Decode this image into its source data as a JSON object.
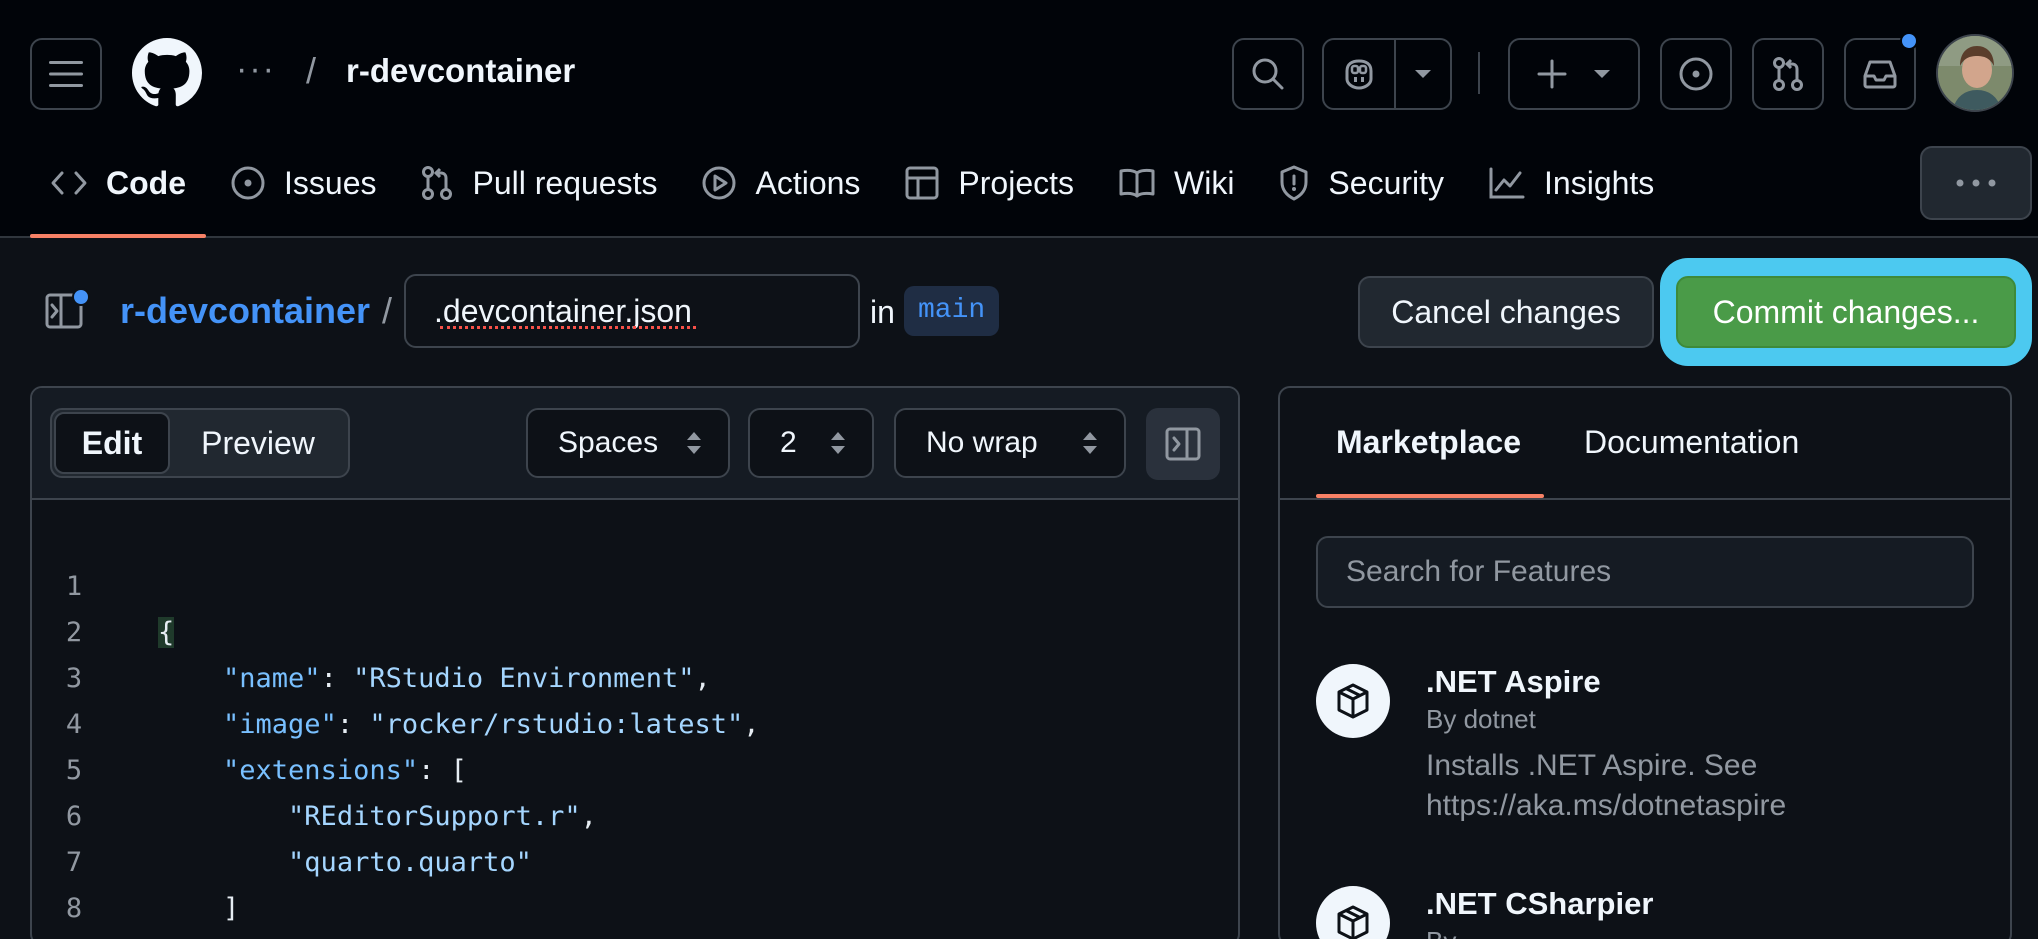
{
  "header": {
    "breadcrumb_dots": "···",
    "breadcrumb_slash": "/",
    "repo_name": "r-devcontainer"
  },
  "nav": {
    "items": [
      {
        "label": "Code",
        "icon": "code-icon",
        "active": true
      },
      {
        "label": "Issues",
        "icon": "issue-opened-icon"
      },
      {
        "label": "Pull requests",
        "icon": "git-pull-request-icon"
      },
      {
        "label": "Actions",
        "icon": "play-icon"
      },
      {
        "label": "Projects",
        "icon": "table-icon"
      },
      {
        "label": "Wiki",
        "icon": "book-icon"
      },
      {
        "label": "Security",
        "icon": "shield-icon"
      },
      {
        "label": "Insights",
        "icon": "graph-icon"
      }
    ]
  },
  "filebar": {
    "repo_link": "r-devcontainer",
    "slash": "/",
    "filename": ".devcontainer.json",
    "in_label": "in",
    "branch": "main",
    "cancel_label": "Cancel changes",
    "commit_label": "Commit changes..."
  },
  "editor": {
    "edit_label": "Edit",
    "preview_label": "Preview",
    "indent_mode": "Spaces",
    "indent_size": "2",
    "wrap_mode": "No wrap",
    "line_numbers": [
      "1",
      "2",
      "3",
      "4",
      "5",
      "6",
      "7",
      "8"
    ],
    "code": {
      "l1": "{",
      "l2_key": "\"name\"",
      "l2_val": "\"RStudio Environment\"",
      "l3_key": "\"image\"",
      "l3_val": "\"rocker/rstudio:latest\"",
      "l4_key": "\"extensions\"",
      "l4_rest": ": [",
      "l5_val": "\"REditorSupport.r\"",
      "l6_val": "\"quarto.quarto\"",
      "l7": "]",
      "l8": "}"
    }
  },
  "side": {
    "tab_marketplace": "Marketplace",
    "tab_documentation": "Documentation",
    "search_placeholder": "Search for Features",
    "features": [
      {
        "name": ".NET Aspire",
        "by": "By dotnet",
        "desc": "Installs .NET Aspire. See https://aka.ms/dotnetaspire"
      },
      {
        "name": ".NET CSharpier",
        "by": "By ...",
        "desc": ""
      }
    ]
  },
  "colors": {
    "accent_blue": "#4493f8",
    "commit_green": "#4a9b48",
    "focus_ring": "#4cc9f0",
    "tab_underline": "#f78166"
  }
}
